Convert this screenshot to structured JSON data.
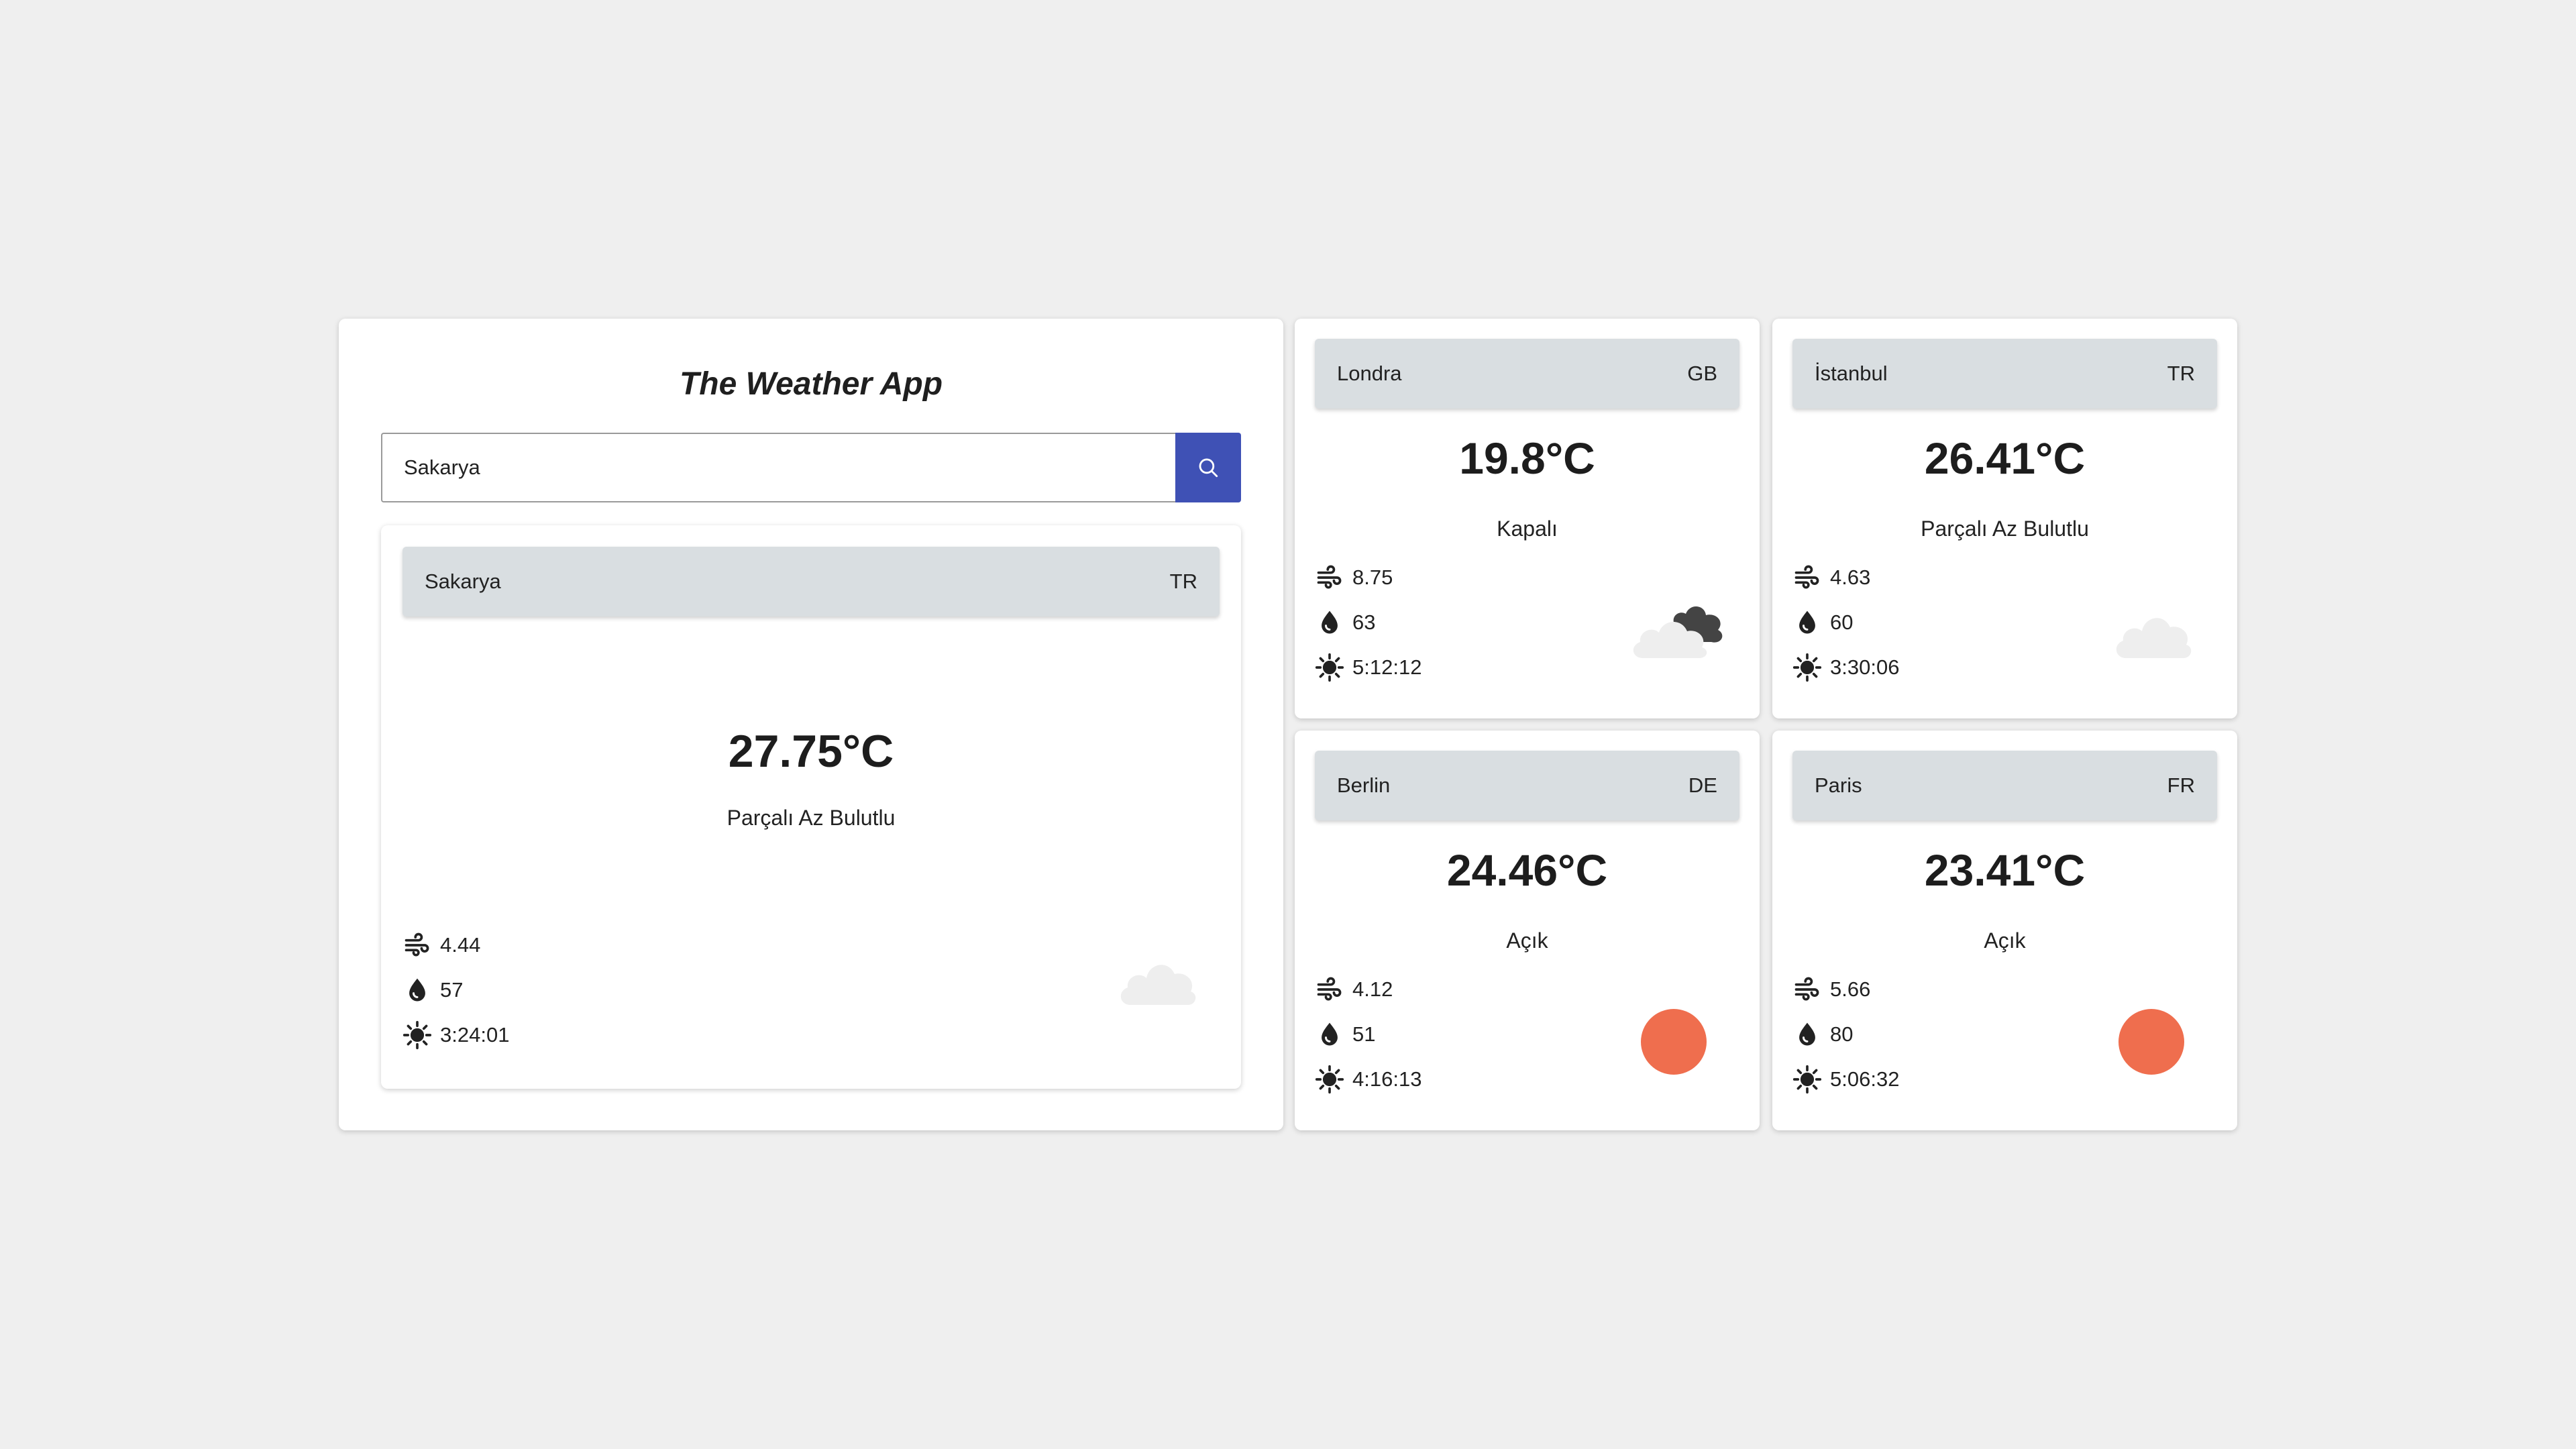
{
  "app": {
    "title": "The Weather App"
  },
  "search": {
    "value": "Sakarya",
    "button_icon": "search-icon"
  },
  "current": {
    "city": "Sakarya",
    "country": "TR",
    "temp": "27.75°C",
    "desc": "Parçalı Az Bulutlu",
    "wind": "4.44",
    "humidity": "57",
    "sun": "3:24:01",
    "icon": "cloud-icon"
  },
  "cities": [
    {
      "city": "Londra",
      "country": "GB",
      "temp": "19.8°C",
      "desc": "Kapalı",
      "wind": "8.75",
      "humidity": "63",
      "sun": "5:12:12",
      "icon": "overcast-cloud-icon"
    },
    {
      "city": "İstanbul",
      "country": "TR",
      "temp": "26.41°C",
      "desc": "Parçalı Az Bulutlu",
      "wind": "4.63",
      "humidity": "60",
      "sun": "3:30:06",
      "icon": "cloud-icon"
    },
    {
      "city": "Berlin",
      "country": "DE",
      "temp": "24.46°C",
      "desc": "Açık",
      "wind": "4.12",
      "humidity": "51",
      "sun": "4:16:13",
      "icon": "sun-icon"
    },
    {
      "city": "Paris",
      "country": "FR",
      "temp": "23.41°C",
      "desc": "Açık",
      "wind": "5.66",
      "humidity": "80",
      "sun": "5:06:32",
      "icon": "sun-icon"
    }
  ],
  "colors": {
    "accent": "#3f51b5",
    "header_bar": "#d9dee1",
    "sun": "#ef6e4e",
    "cloud_light": "#eeeeee",
    "cloud_dark": "#444444",
    "background": "#efefef"
  }
}
